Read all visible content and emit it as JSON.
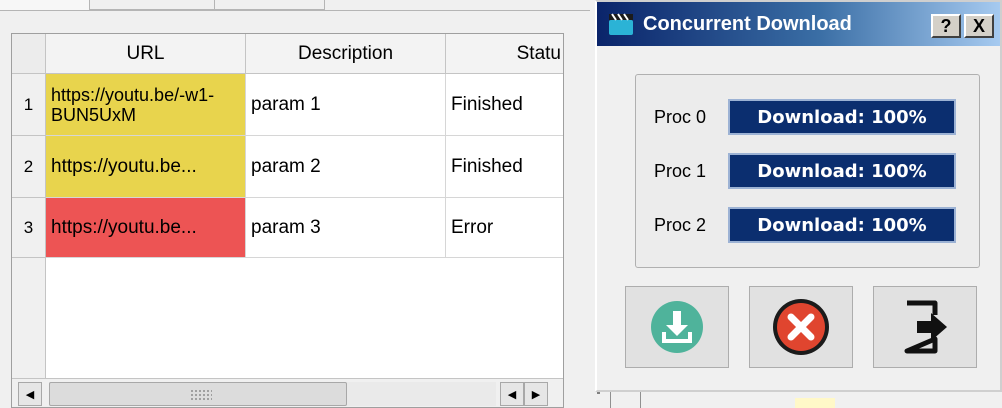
{
  "table": {
    "columns": [
      "URL",
      "Description",
      "Statu"
    ],
    "rows": [
      {
        "num": "1",
        "url": "https://youtu.be/-w1-BUN5UxM",
        "description": "param 1",
        "status": "Finished",
        "color": "#e8d44d"
      },
      {
        "num": "2",
        "url": "https://youtu.be...",
        "description": "param 2",
        "status": "Finished",
        "color": "#e8d44d"
      },
      {
        "num": "3",
        "url": "https://youtu.be...",
        "description": "param 3",
        "status": "Error",
        "color": "#ed5454"
      }
    ]
  },
  "dialog": {
    "title": "Concurrent Download",
    "help_label": "?",
    "close_label": "X",
    "processes": [
      {
        "label": "Proc 0",
        "text": "Download: 100%",
        "progress": 1.0
      },
      {
        "label": "Proc 1",
        "text": "Download: 100%",
        "progress": 1.0
      },
      {
        "label": "Proc 2",
        "text": "Download: 100%",
        "progress": 1.0
      }
    ],
    "buttons": {
      "download_icon": "download-icon",
      "cancel_icon": "cancel-icon",
      "exit_icon": "exit-icon"
    }
  },
  "colors": {
    "accent": "#0b2e6f",
    "finished_row": "#e8d44d",
    "error_row": "#ed5454",
    "download_button": "#4fb39b",
    "cancel_button": "#e0452f"
  }
}
